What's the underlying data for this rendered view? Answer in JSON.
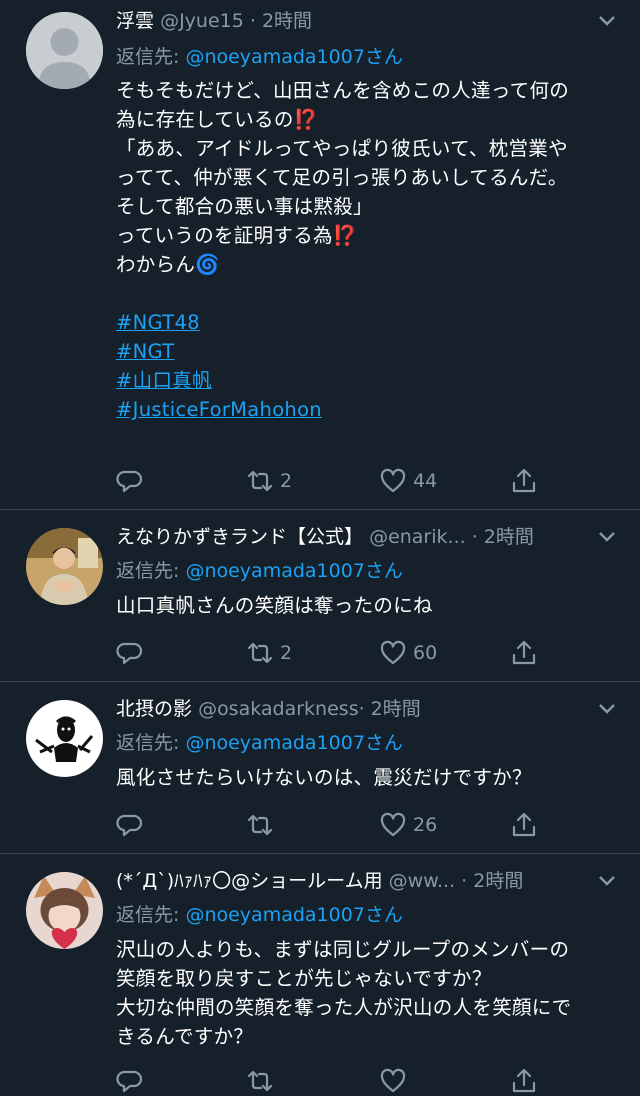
{
  "tweets": [
    {
      "name": "浮雲",
      "handle": "@Jyue15",
      "time": "· 2時間",
      "reply_label": "返信先:",
      "reply_to": "@noeyamada1007さん",
      "lines": [
        "そもそもだけど、山田さんを含めこの人達って何の",
        "為に存在しているの⁉️",
        "「ああ、アイドルってやっぱり彼氏いて、枕営業や",
        "ってて、仲が悪くて足の引っ張りあいしてるんだ。",
        "そして都合の悪い事は黙殺」",
        "っていうのを証明する為⁉️",
        "",
        "わからん🌀"
      ],
      "hashtags": [
        "#NGT48",
        "#NGT",
        "#山口真帆",
        "#JusticeForMahohon"
      ],
      "retweets": "2",
      "likes": "44",
      "avatar": "default-avatar"
    },
    {
      "name": "えなりかずきランド【公式】",
      "handle": "@enarik...",
      "time": "· 2時間",
      "reply_label": "返信先:",
      "reply_to": "@noeyamada1007さん",
      "lines": [
        "山口真帆さんの笑顔は奪ったのにね"
      ],
      "retweets": "2",
      "likes": "60",
      "avatar": "photo-person"
    },
    {
      "name": "北摂の影",
      "handle": "@osakadarkness",
      "time": "· 2時間",
      "reply_label": "返信先:",
      "reply_to": "@noeyamada1007さん",
      "lines": [
        "風化させたらいけないのは、震災だけですか？"
      ],
      "retweets": "",
      "likes": "26",
      "avatar": "ink-figure"
    },
    {
      "name": "(*´Д`)ﾊｧﾊｧ〇@ショールーム用",
      "handle": "@ww...",
      "time": "· 2時間",
      "reply_label": "返信先:",
      "reply_to": "@noeyamada1007さん",
      "lines": [
        "沢山の人よりも、まずは同じグループのメンバーの",
        "笑顔を取り戻すことが先じゃないですか？",
        "大切な仲間の笑顔を奪った人が沢山の人を笑顔にで",
        "きるんですか？"
      ],
      "avatar": "photo-cat-ears"
    }
  ],
  "colors": {
    "background": "#15202b",
    "muted": "#8899a6",
    "link": "#1da1f2",
    "divider": "#38444d"
  }
}
